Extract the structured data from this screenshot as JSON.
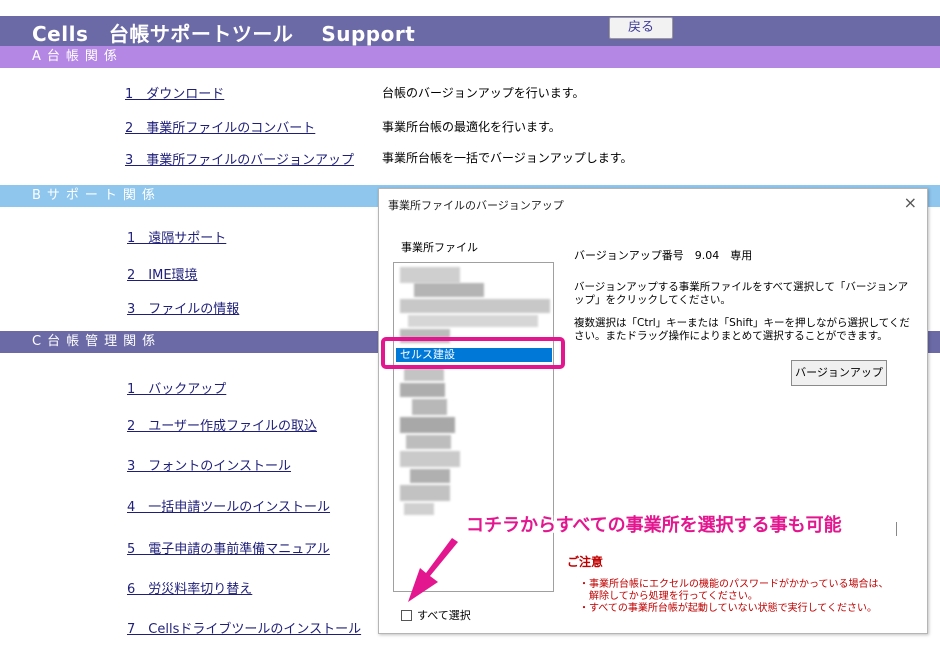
{
  "header": {
    "app_title": "Cells　台帳サポートツール　 Support",
    "back_label": "戻る"
  },
  "sections": {
    "a": "A台帳関係",
    "b": "Bサポート関係",
    "c": "C台帳管理関係"
  },
  "menu_a": [
    {
      "label": "1　ダウンロード",
      "desc": "台帳のバージョンアップを行います。"
    },
    {
      "label": "2　事業所ファイルのコンバート",
      "desc": "事業所台帳の最適化を行います。"
    },
    {
      "label": "3　事業所ファイルのバージョンアップ",
      "desc": "事業所台帳を一括でバージョンアップします。"
    }
  ],
  "menu_b": [
    {
      "label": "1　遠隔サポート"
    },
    {
      "label": "2　IME環境"
    },
    {
      "label": "3　ファイルの情報"
    }
  ],
  "menu_c": [
    {
      "label": "1　バックアップ"
    },
    {
      "label": "2　ユーザー作成ファイルの取込"
    },
    {
      "label": "3　フォントのインストール"
    },
    {
      "label": "4　一括申請ツールのインストール"
    },
    {
      "label": "5　電子申請の事前準備マニュアル"
    },
    {
      "label": "6　労災料率切り替え"
    },
    {
      "label": "7　Cellsドライブツールのインストール"
    }
  ],
  "dialog": {
    "title": "事業所ファイルのバージョンアップ",
    "close_symbol": "×",
    "list_label": "事業所ファイル",
    "selected_item": "セルス建設",
    "version_text": "バージョンアップ番号　9.04　専用",
    "instruction1": "バージョンアップする事業所ファイルをすべて選択して「バージョンアップ」をクリックしてください。",
    "instruction2": "複数選択は「Ctrl」キーまたは「Shift」キーを押しながら選択してください。またドラッグ操作によりまとめて選択することができます。",
    "version_up_button": "バージョンアップ",
    "caution_title": "ご注意",
    "caution_lines": [
      "・事業所台帳にエクセルの機能のパスワードがかかっている場合は、",
      "　解除してから処理を行ってください。",
      "・すべての事業所台帳が起動していない状態で実行してください。"
    ],
    "select_all_label": "すべて選択"
  },
  "annotation": {
    "text": "コチラからすべての事業所を選択する事も可能",
    "color": "#e4168f"
  }
}
